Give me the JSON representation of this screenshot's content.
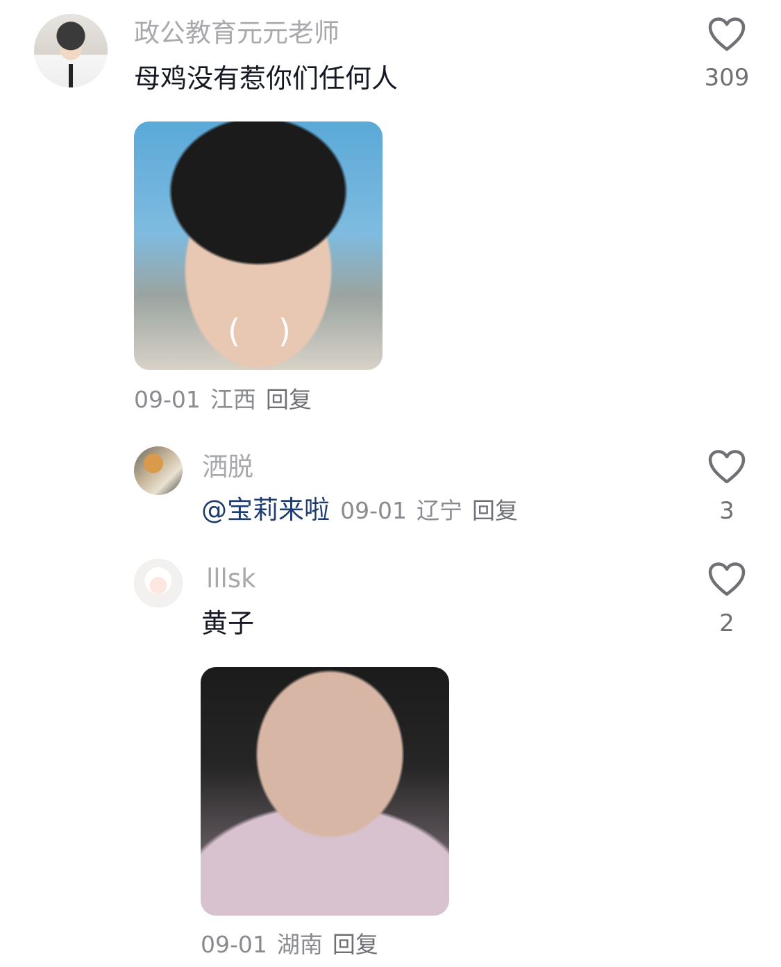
{
  "comments": [
    {
      "username": "政公教育元元老师",
      "text": "母鸡没有惹你们任何人",
      "likes": "309",
      "date": "09-01",
      "location": "江西",
      "reply_label": "回复",
      "image_overlay_left": "(",
      "image_overlay_right": ")"
    }
  ],
  "replies": [
    {
      "username": "洒脱",
      "mention": "@宝莉来啦",
      "date": "09-01",
      "location": "辽宁",
      "reply_label": "回复",
      "likes": "3"
    },
    {
      "username": "lllsk",
      "text": "黄子",
      "date": "09-01",
      "location": "湖南",
      "reply_label": "回复",
      "likes": "2"
    }
  ],
  "icons": {
    "like": "heart-outline-icon"
  },
  "colors": {
    "username": "#a8a9ad",
    "text": "#161823",
    "meta": "#8a8b91",
    "mention": "#1f3c6e",
    "icon": "#6f7076"
  }
}
